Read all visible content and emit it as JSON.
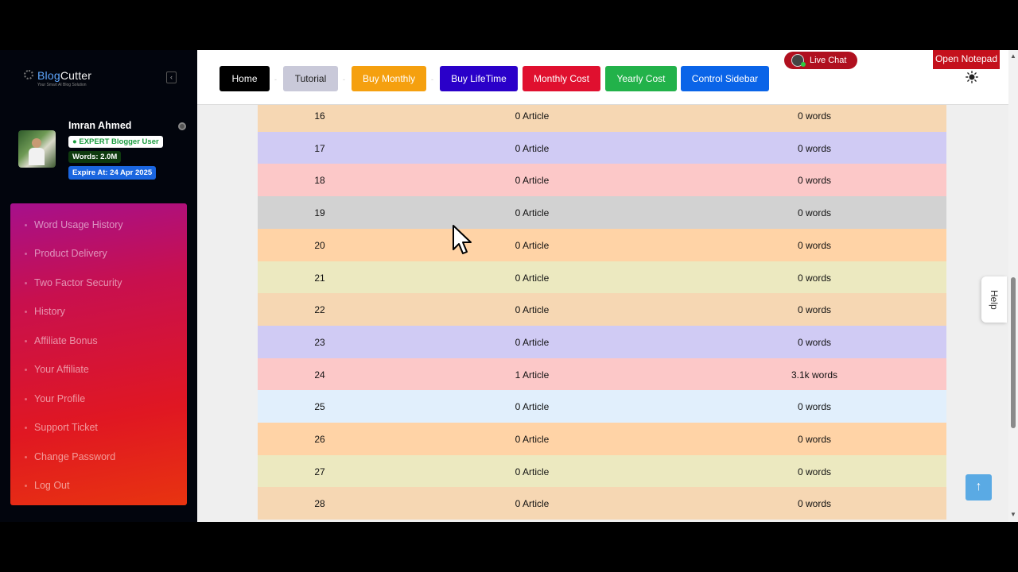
{
  "sidebar": {
    "logo": {
      "part1": "Blog",
      "part2": "Cutter",
      "tagline": "Your Smart AI Blog Solution"
    },
    "user": {
      "name": "Imran Ahmed",
      "badge": "● EXPERT Blogger User",
      "words": "Words: 2.0M",
      "expire": "Expire At: 24 Apr 2025"
    },
    "menu": [
      "Word Usage History",
      "Product Delivery",
      "Two Factor Security",
      "History",
      "Affiliate Bonus",
      "Your Affiliate",
      "Your Profile",
      "Support Ticket",
      "Change Password",
      "Log Out"
    ]
  },
  "nav": {
    "buttons": [
      {
        "label": "Home",
        "bg": "#000000",
        "fg": "#ffffff"
      },
      {
        "label": "Tutorial",
        "bg": "#c9c9d9",
        "fg": "#222222"
      },
      {
        "label": "Buy Monthly",
        "bg": "#f5a00f",
        "fg": "#ffffff"
      },
      {
        "label": "Buy LifeTime",
        "bg": "#2a00c9",
        "fg": "#ffffff"
      },
      {
        "label": "Monthly Cost",
        "bg": "#e0102f",
        "fg": "#ffffff"
      },
      {
        "label": "Yearly Cost",
        "bg": "#22b24a",
        "fg": "#ffffff"
      },
      {
        "label": "Control Sidebar",
        "bg": "#0a64e8",
        "fg": "#ffffff"
      }
    ],
    "separator": "-",
    "live_chat": "Live Chat",
    "open_notepad": "Open Notepad"
  },
  "table": {
    "rows": [
      {
        "day": "16",
        "articles": "0 Article",
        "words": "0 words",
        "bg": "#f6d7b3"
      },
      {
        "day": "17",
        "articles": "0 Article",
        "words": "0 words",
        "bg": "#d0cbf4"
      },
      {
        "day": "18",
        "articles": "0 Article",
        "words": "0 words",
        "bg": "#fcc8c8"
      },
      {
        "day": "19",
        "articles": "0 Article",
        "words": "0 words",
        "bg": "#d2d2d2"
      },
      {
        "day": "20",
        "articles": "0 Article",
        "words": "0 words",
        "bg": "#ffd3a6"
      },
      {
        "day": "21",
        "articles": "0 Article",
        "words": "0 words",
        "bg": "#ece9c0"
      },
      {
        "day": "22",
        "articles": "0 Article",
        "words": "0 words",
        "bg": "#f6d7b3"
      },
      {
        "day": "23",
        "articles": "0 Article",
        "words": "0 words",
        "bg": "#d0cbf4"
      },
      {
        "day": "24",
        "articles": "1 Article",
        "words": "3.1k words",
        "bg": "#fcc8c8"
      },
      {
        "day": "25",
        "articles": "0 Article",
        "words": "0 words",
        "bg": "#e1effc"
      },
      {
        "day": "26",
        "articles": "0 Article",
        "words": "0 words",
        "bg": "#ffd3a6"
      },
      {
        "day": "27",
        "articles": "0 Article",
        "words": "0 words",
        "bg": "#ece9c0"
      },
      {
        "day": "28",
        "articles": "0 Article",
        "words": "0 words",
        "bg": "#f6d7b3"
      }
    ]
  },
  "help_tab": "Help"
}
